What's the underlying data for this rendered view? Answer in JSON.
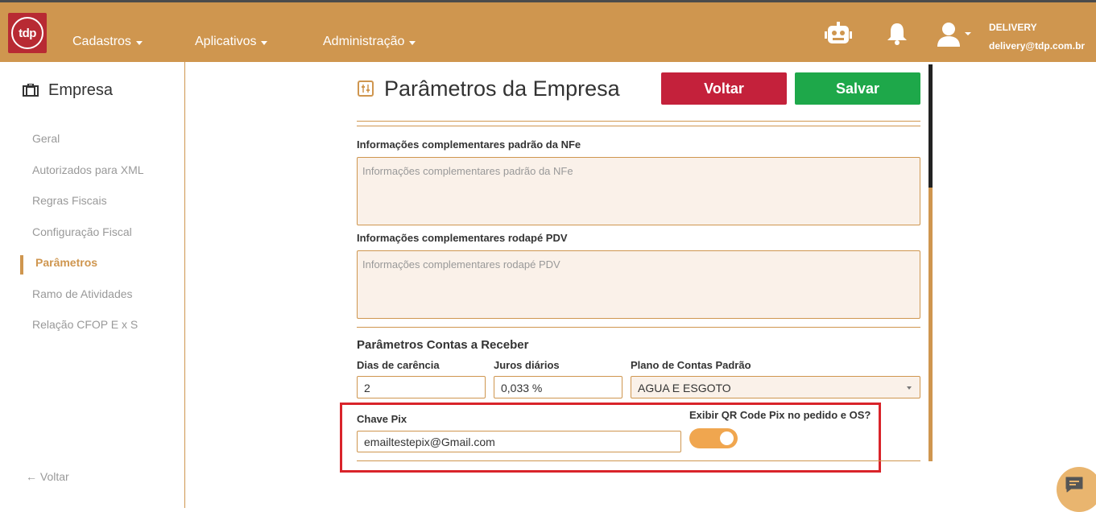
{
  "header": {
    "logo_text": "tdp",
    "nav": [
      {
        "label": "Cadastros"
      },
      {
        "label": "Aplicativos"
      },
      {
        "label": "Administração"
      }
    ],
    "user": {
      "name": "DELIVERY",
      "email": "delivery@tdp.com.br"
    },
    "icons": [
      "robot-icon",
      "bell-icon",
      "user-icon"
    ]
  },
  "sidebar": {
    "title": "Empresa",
    "items": [
      {
        "label": "Geral"
      },
      {
        "label": "Autorizados para XML"
      },
      {
        "label": "Regras Fiscais"
      },
      {
        "label": "Configuração Fiscal"
      },
      {
        "label": "Parâmetros",
        "active": true
      },
      {
        "label": "Ramo de Atividades"
      },
      {
        "label": "Relação CFOP E x S"
      }
    ],
    "back_label": "Voltar"
  },
  "main": {
    "title": "Parâmetros da Empresa",
    "buttons": {
      "back": "Voltar",
      "save": "Salvar"
    },
    "nfe_info": {
      "label": "Informações complementares padrão da NFe",
      "placeholder": "Informações complementares padrão da NFe"
    },
    "pdv_info": {
      "label": "Informações complementares rodapé PDV",
      "placeholder": "Informações complementares rodapé PDV"
    },
    "receivables": {
      "section_title": "Parâmetros Contas a Receber",
      "grace_days": {
        "label": "Dias de carência",
        "value": "2"
      },
      "daily_interest": {
        "label": "Juros diários",
        "value": "0,033 %"
      },
      "chart_of_accounts": {
        "label": "Plano de Contas Padrão",
        "value": "AGUA E ESGOTO"
      }
    },
    "pix": {
      "key_label": "Chave Pix",
      "key_value": "emailtestepix@Gmail.com",
      "qr_label": "Exibir QR Code Pix no pedido e OS?",
      "qr_enabled": true
    }
  },
  "colors": {
    "primary": "#cf964f",
    "danger": "#c4213b",
    "success": "#1ea84a",
    "highlight": "#d9242a",
    "toggle": "#f0a64f"
  }
}
